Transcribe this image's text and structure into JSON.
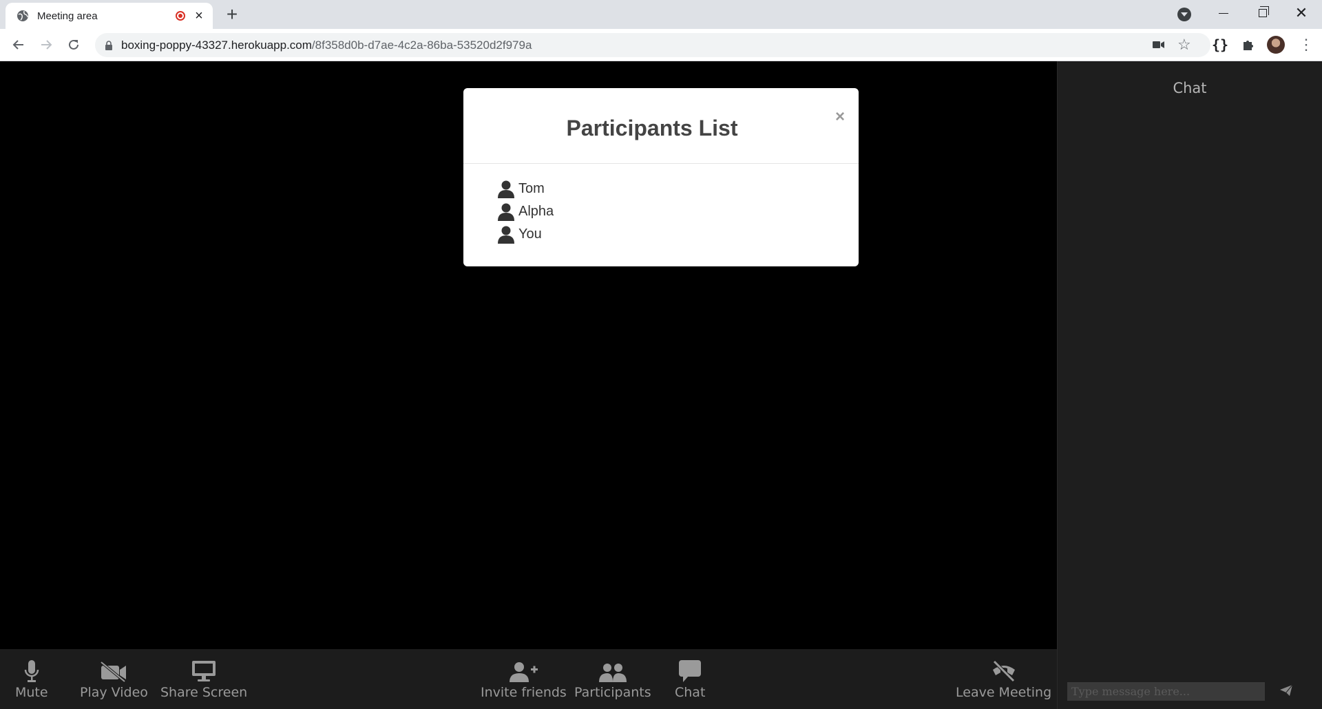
{
  "browser": {
    "tab_title": "Meeting area",
    "new_tab": "+",
    "url_host": "boxing-poppy-43327.herokuapp.com",
    "url_path": "/8f358d0b-d7ae-4c2a-86ba-53520d2f979a",
    "close_tab": "×",
    "win_close": "✕",
    "ext_label": "{}"
  },
  "modal": {
    "title": "Participants List",
    "close_label": "×",
    "participants": [
      {
        "name": "Tom"
      },
      {
        "name": "Alpha"
      },
      {
        "name": "You"
      }
    ]
  },
  "controls": {
    "mute": "Mute",
    "play_video": "Play Video",
    "share_screen": "Share Screen",
    "invite": "Invite friends",
    "participants": "Participants",
    "chat": "Chat",
    "leave": "Leave Meeting"
  },
  "chat": {
    "title": "Chat",
    "placeholder": "Type message here..."
  },
  "colors": {
    "stage_bg": "#000000",
    "panel_bg": "#1e1e1e",
    "control_text": "#9a9a9a",
    "recording_dot": "#d93025"
  }
}
